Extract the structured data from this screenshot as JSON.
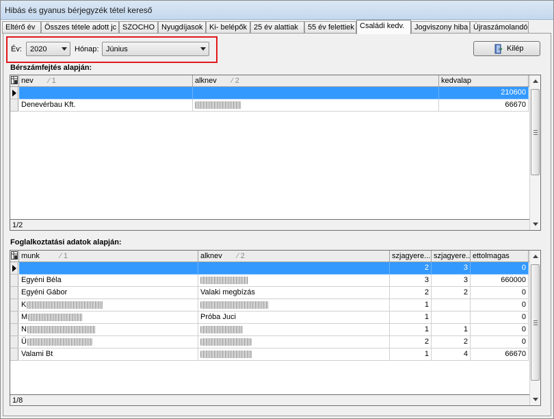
{
  "window": {
    "title": "Hibás és gyanus bérjegyzék tétel kereső"
  },
  "tabs": [
    {
      "label": "Eltérő év"
    },
    {
      "label": "Összes tétele adott jc"
    },
    {
      "label": "SZOCHO"
    },
    {
      "label": "Nyugdíjasok"
    },
    {
      "label": "Ki- belépők"
    },
    {
      "label": "25 év alattiak"
    },
    {
      "label": "55 év felettiek"
    },
    {
      "label": "Családi kedv."
    },
    {
      "label": "Jogviszony hiba"
    },
    {
      "label": "Újraszámolandó"
    }
  ],
  "active_tab_index": 7,
  "filters": {
    "year_label": "Év:",
    "year_value": "2020",
    "month_label": "Hónap:",
    "month_value": "Június"
  },
  "toolbar": {
    "exit_label": "Kilép"
  },
  "payroll": {
    "title": "Bérszámfejtés alapján:",
    "columns": [
      {
        "name": "nev",
        "sort": "1"
      },
      {
        "name": "alknev",
        "sort": "2"
      },
      {
        "name": "kedvalap",
        "sort": ""
      }
    ],
    "rows": [
      {
        "nev": "",
        "alknev": "",
        "kedvalap": "210600",
        "selected": true
      },
      {
        "nev": "Denevérbau Kft.",
        "alknev": "",
        "alknev_redacted": true,
        "kedvalap": "66670",
        "selected": false
      }
    ],
    "status": "1/2"
  },
  "employment": {
    "title": "Foglalkoztatási adatok alapján:",
    "columns": [
      {
        "name": "munk",
        "sort": "1"
      },
      {
        "name": "alknev",
        "sort": "2"
      },
      {
        "name": "szjagyere...",
        "sort": ""
      },
      {
        "name": "szjagyere...",
        "sort": ""
      },
      {
        "name": "ettolmagas",
        "sort": ""
      }
    ],
    "rows": [
      {
        "munk": "",
        "munk_redacted": false,
        "alknev": "",
        "alknev_redacted": false,
        "c1": "2",
        "c2": "3",
        "ettol": "0",
        "selected": true
      },
      {
        "munk": "Egyéni Béla",
        "munk_redacted": false,
        "alknev": "",
        "alknev_redacted": true,
        "c1": "3",
        "c2": "3",
        "ettol": "660000",
        "selected": false
      },
      {
        "munk": "Egyéni Gábor",
        "munk_redacted": false,
        "alknev": "Valaki megbízás",
        "alknev_redacted": false,
        "c1": "2",
        "c2": "2",
        "ettol": "0",
        "selected": false
      },
      {
        "munk": "K",
        "munk_redacted": true,
        "alknev": "",
        "alknev_redacted": true,
        "c1": "1",
        "c2": "",
        "ettol": "0",
        "selected": false
      },
      {
        "munk": "M",
        "munk_redacted": true,
        "alknev": "Próba Juci",
        "alknev_redacted": false,
        "c1": "1",
        "c2": "",
        "ettol": "0",
        "selected": false
      },
      {
        "munk": "N",
        "munk_redacted": true,
        "alknev": "",
        "alknev_redacted": true,
        "c1": "1",
        "c2": "1",
        "ettol": "0",
        "selected": false
      },
      {
        "munk": "Ü",
        "munk_redacted": true,
        "alknev": "",
        "alknev_redacted": true,
        "c1": "2",
        "c2": "2",
        "ettol": "0",
        "selected": false
      },
      {
        "munk": "Valami Bt",
        "munk_redacted": false,
        "alknev": "",
        "alknev_redacted": true,
        "c1": "1",
        "c2": "4",
        "ettol": "66670",
        "selected": false
      }
    ],
    "status": "1/8"
  },
  "icons": {
    "exit": "door-exit-icon",
    "grid_corner": "grid-options-icon",
    "row_pointer": "row-pointer-icon"
  },
  "colors": {
    "selection": "#3399ff",
    "highlight_border": "#e0161a"
  }
}
